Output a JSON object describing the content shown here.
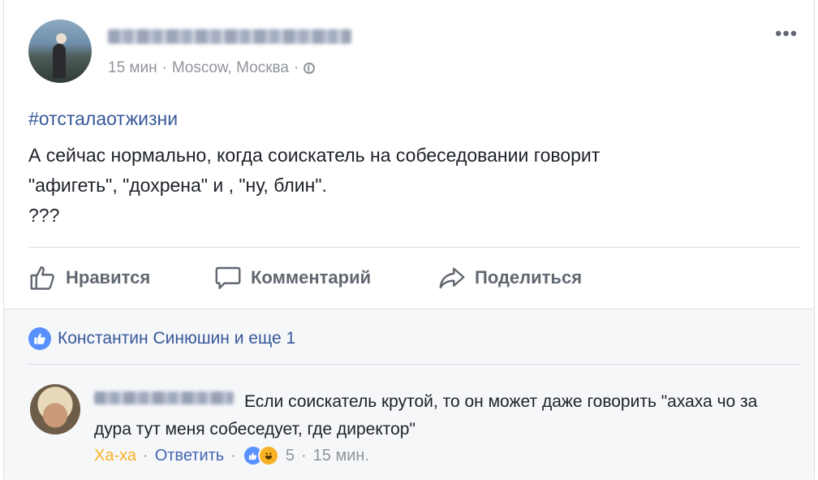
{
  "post": {
    "timestamp": "15 мин",
    "location": "Moscow, Москва",
    "hashtag": "#отсталаотжизни",
    "lines": [
      "А сейчас нормально, когда соискатель на собеседовании говорит",
      "\"афигеть\", \"дохрена\" и , \"ну, блин\".",
      "???"
    ],
    "more_label": "•••"
  },
  "actions": {
    "like": "Нравится",
    "comment": "Комментарий",
    "share": "Поделиться"
  },
  "reactions_summary": "Константин Синюшин и еще 1",
  "comment": {
    "text": "Если соискатель крутой, то он может даже говорить \"ахаха чо за дура тут меня собеседует, где директор\"",
    "reaction_label": "Ха-ха",
    "reply_label": "Ответить",
    "reaction_count": "5",
    "timestamp": "15 мин."
  },
  "separator": "·",
  "icons": {
    "like": "thumb-up-icon",
    "comment": "speech-bubble-icon",
    "share": "share-arrow-icon",
    "globe": "globe-icon",
    "more": "ellipsis-icon"
  },
  "colors": {
    "link": "#365899",
    "haha": "#f7b125",
    "reply": "#4267b2",
    "like_badge": "#5890ff"
  }
}
